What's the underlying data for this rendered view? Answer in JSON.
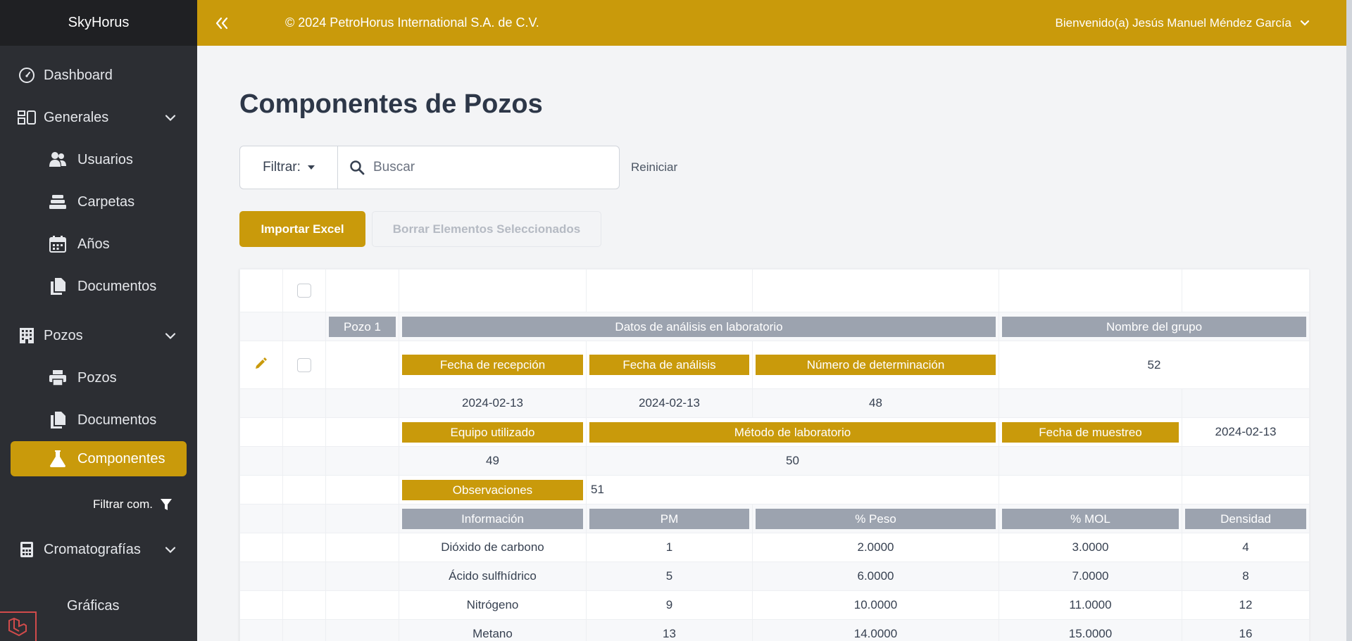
{
  "app": {
    "brand": "SkyHorus",
    "copyright": "© 2024 PetroHorus International S.A. de C.V.",
    "welcome": "Bienvenido(a) Jesús Manuel Méndez García"
  },
  "sidebar": {
    "dashboard": "Dashboard",
    "generales": "Generales",
    "usuarios": "Usuarios",
    "carpetas": "Carpetas",
    "anios": "Años",
    "documentos": "Documentos",
    "pozos_group": "Pozos",
    "pozos": "Pozos",
    "pozos_documentos": "Documentos",
    "componentes": "Componentes",
    "filtrar_com": "Filtrar com.",
    "cromatografias": "Cromatografías",
    "graficas": "Gráficas"
  },
  "page": {
    "title": "Componentes de Pozos",
    "filter_label": "Filtrar:",
    "search_placeholder": "Buscar",
    "reset_label": "Reiniciar",
    "import_label": "Importar Excel",
    "delete_label": "Borrar Elementos Seleccionados"
  },
  "record": {
    "pozo": "Pozo 1",
    "datos_header": "Datos de análisis en laboratorio",
    "grupo_header": "Nombre del grupo",
    "fecha_recepcion_label": "Fecha de recepción",
    "fecha_analisis_label": "Fecha de análisis",
    "numero_determinacion_label": "Número de determinación",
    "nombre_grupo_value": "52",
    "fecha_recepcion": "2024-02-13",
    "fecha_analisis": "2024-02-13",
    "numero_determinacion": "48",
    "equipo_label": "Equipo utilizado",
    "metodo_label": "Método de laboratorio",
    "fecha_muestreo_label": "Fecha de muestreo",
    "fecha_muestreo": "2024-02-13",
    "equipo": "49",
    "metodo": "50",
    "observaciones_label": "Observaciones",
    "observaciones": "51"
  },
  "components": {
    "headers": [
      "Información",
      "PM",
      "% Peso",
      "% MOL",
      "Densidad"
    ],
    "rows": [
      [
        "Dióxido de carbono",
        "1",
        "2.0000",
        "3.0000",
        "4"
      ],
      [
        "Ácido sulfhídrico",
        "5",
        "6.0000",
        "7.0000",
        "8"
      ],
      [
        "Nitrógeno",
        "9",
        "10.0000",
        "11.0000",
        "12"
      ],
      [
        "Metano",
        "13",
        "14.0000",
        "15.0000",
        "16"
      ]
    ]
  },
  "colors": {
    "accent": "#c99a0b",
    "sidebar": "#2c2e33",
    "header_gray": "#9ca3af"
  }
}
